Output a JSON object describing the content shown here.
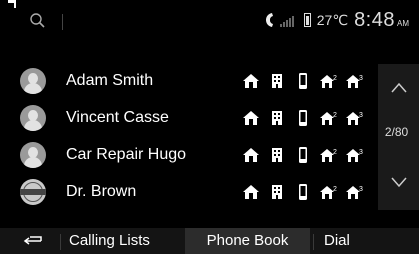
{
  "status": {
    "temperature": "27℃",
    "time": "8:48",
    "ampm": "AM"
  },
  "contacts": [
    {
      "name": "Adam Smith",
      "avatar": "person-avatar"
    },
    {
      "name": "Vincent Casse",
      "avatar": "person-avatar"
    },
    {
      "name": "Car Repair Hugo",
      "avatar": "person-avatar"
    },
    {
      "name": "Dr. Brown",
      "avatar": "nissan-logo"
    }
  ],
  "contact_number_types": [
    "home-phone-icon",
    "office-phone-icon",
    "mobile-phone-icon",
    "home-2-phone-icon",
    "home-3-phone-icon"
  ],
  "pager": {
    "label": "2/80"
  },
  "tabs": [
    {
      "label": "Calling Lists",
      "active": false
    },
    {
      "label": "Phone Book",
      "active": true
    },
    {
      "label": "Dial",
      "active": false
    }
  ]
}
